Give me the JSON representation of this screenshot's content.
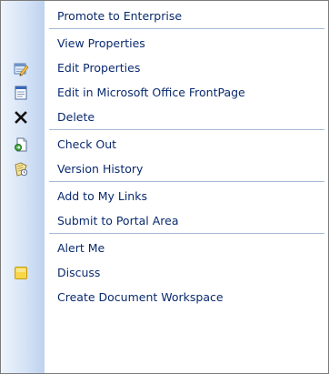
{
  "menu": {
    "items": [
      {
        "label": "Promote to Enterprise"
      },
      {
        "label": "View Properties"
      },
      {
        "label": "Edit Properties",
        "icon": "edit-properties-icon"
      },
      {
        "label": "Edit in Microsoft Office FrontPage",
        "icon": "frontpage-icon"
      },
      {
        "label": "Delete",
        "icon": "delete-icon"
      },
      {
        "label": "Check Out",
        "icon": "check-out-icon"
      },
      {
        "label": "Version History",
        "icon": "version-history-icon"
      },
      {
        "label": "Add to My Links"
      },
      {
        "label": "Submit to Portal Area"
      },
      {
        "label": "Alert Me"
      },
      {
        "label": "Discuss",
        "icon": "discuss-icon"
      },
      {
        "label": "Create Document Workspace"
      }
    ]
  },
  "colors": {
    "text": "#0a2a6e",
    "separator": "#a7b9d6",
    "gutter_light": "#eef4fc",
    "gutter_dark": "#bed2ee",
    "border": "#7b7b7b"
  }
}
